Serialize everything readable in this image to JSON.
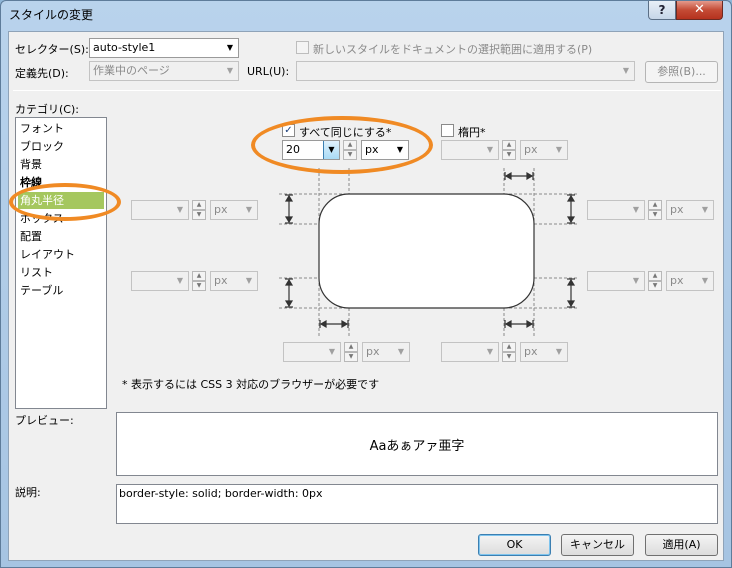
{
  "window": {
    "title": "スタイルの変更",
    "help_label": "?",
    "close_label": "✕"
  },
  "selector": {
    "label": "セレクター(S):",
    "value": "auto-style1",
    "new_style_checkbox_label": "新しいスタイルをドキュメントの選択範囲に適用する(P)"
  },
  "definition": {
    "label": "定義先(D):",
    "value": "作業中のページ",
    "url_label": "URL(U):",
    "url_value": "",
    "browse_label": "参照(B)..."
  },
  "category": {
    "label": "カテゴリ(C):",
    "items": [
      "フォント",
      "ブロック",
      "背景",
      "枠線",
      "角丸半径",
      "ボックス",
      "配置",
      "レイアウト",
      "リスト",
      "テーブル"
    ],
    "selected": "角丸半径",
    "bold": "枠線"
  },
  "radius": {
    "same_all_label": "すべて同じにする*",
    "same_all_checked": true,
    "ellipse_label": "楕円*",
    "ellipse_checked": false,
    "value": "20",
    "unit": "px",
    "disabled_unit": "px",
    "note": "* 表示するには CSS 3 対応のブラウザーが必要です"
  },
  "preview": {
    "label": "プレビュー:",
    "sample": "Aaあぁアァ亜字"
  },
  "description": {
    "label": "説明:",
    "text": "border-style: solid; border-width: 0px"
  },
  "buttons": {
    "ok": "OK",
    "cancel": "キャンセル",
    "apply": "適用(A)"
  },
  "colors": {
    "highlight_ring": "#f08a24",
    "selected_item": "#a5c75f"
  }
}
